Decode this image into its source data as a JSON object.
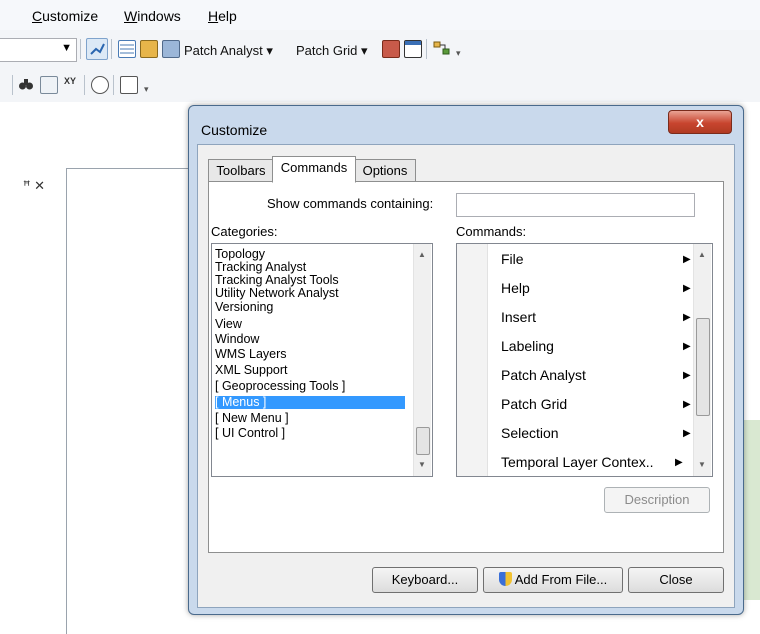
{
  "menubar": {
    "items": [
      {
        "label": "Customize",
        "underline": "C",
        "rest": "ustomize"
      },
      {
        "label": "Windows",
        "underline": "W",
        "rest": "indows"
      },
      {
        "label": "Help",
        "underline": "H",
        "rest": "elp"
      }
    ]
  },
  "toolbar": {
    "patch_analyst": "Patch Analyst",
    "patch_grid": "Patch Grid",
    "dropdown_caret": "▾"
  },
  "dialog": {
    "title": "Customize",
    "close_glyph": "x",
    "tabs": [
      "Toolbars",
      "Commands",
      "Options"
    ],
    "active_tab": "Commands",
    "show_commands_label": "Show commands containing:",
    "search_value": "",
    "categories_label": "Categories:",
    "commands_label": "Commands:",
    "categories": [
      "Topology",
      "Tracking Analyst",
      "Tracking Analyst Tools",
      "Utility Network Analyst",
      "Versioning",
      "View",
      "Window",
      "WMS Layers",
      "XML Support",
      "[ Geoprocessing Tools ]",
      "[ Menus ]",
      "[ New Menu ]",
      "[ UI Control ]"
    ],
    "selected_category": "[ Menus ]",
    "commands": [
      "File",
      "Help",
      "Insert",
      "Labeling",
      "Patch Analyst",
      "Patch Grid",
      "Selection",
      "Temporal Layer Contex.."
    ],
    "description_button": "Description",
    "keyboard_button": "Keyboard...",
    "add_from_file_button": "Add From File...",
    "close_button": "Close"
  },
  "colors": {
    "selection": "#3399ff",
    "close_red": "#c8452f",
    "dialog_frame": "#c9d9ec"
  }
}
